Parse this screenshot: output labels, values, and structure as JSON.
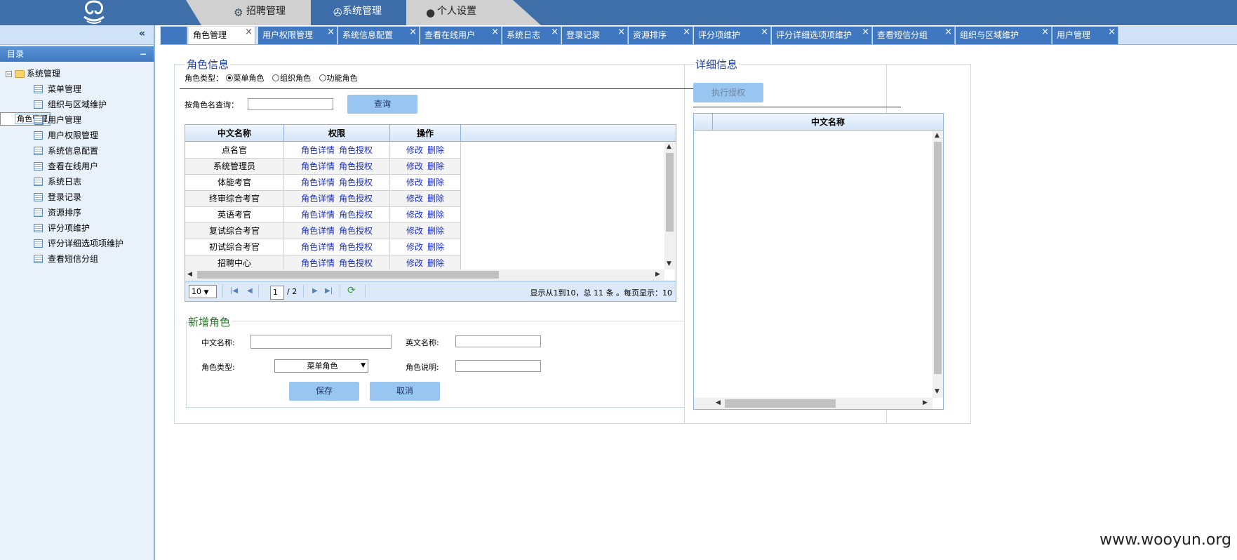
{
  "nav": {
    "tabs": [
      {
        "label": "招聘管理",
        "icon": "recruit-icon"
      },
      {
        "label": "系统管理",
        "icon": "gear-wheel-icon"
      },
      {
        "label": "个人设置",
        "icon": "user-icon"
      }
    ]
  },
  "sidebar": {
    "collapse_glyph": "«",
    "heading": "目录",
    "heading_toggle": "−",
    "root": "系统管理",
    "items": [
      "菜单管理",
      "组织与区域维护",
      "角色管理",
      "用户管理",
      "用户权限管理",
      "系统信息配置",
      "查看在线用户",
      "系统日志",
      "登录记录",
      "资源排序",
      "评分项维护",
      "评分详细选项项维护",
      "查看短信分组"
    ],
    "selected_index": 2
  },
  "content_tabs": [
    "角色管理",
    "用户权限管理",
    "系统信息配置",
    "查看在线用户",
    "系统日志",
    "登录记录",
    "资源排序",
    "评分项维护",
    "评分详细选项项维护",
    "查看短信分组",
    "组织与区域维护",
    "用户管理"
  ],
  "role_info": {
    "title": "角色信息",
    "type_label": "角色类型：",
    "types": [
      "菜单角色",
      "组织角色",
      "功能角色"
    ],
    "search_label": "按角色名查询：",
    "search_value": "",
    "search_button": "查询"
  },
  "grid": {
    "columns": [
      "中文名称",
      "权限",
      "操作"
    ],
    "link_detail": "角色详情",
    "link_grant": "角色授权",
    "link_edit": "修改",
    "link_delete": "删除",
    "rows": [
      "点名官",
      "系统管理员",
      "体能考官",
      "终审综合考官",
      "英语考官",
      "复试综合考官",
      "初试综合考官",
      "招聘中心"
    ]
  },
  "pager": {
    "page_size": "10",
    "current_page": "1",
    "total_pages": "/ 2",
    "summary": "显示从1到10，总 11 条 。每页显示：10"
  },
  "add_role": {
    "title": "新增角色",
    "cn_name_label": "中文名称:",
    "en_name_label": "英文名称:",
    "type_label": "角色类型:",
    "type_value": "菜单角色",
    "desc_label": "角色说明:",
    "save_button": "保存",
    "cancel_button": "取消"
  },
  "detail": {
    "title": "详细信息",
    "grant_button": "执行授权",
    "column": "中文名称"
  },
  "watermark": "www.wooyun.org",
  "colors": {
    "topbar": "#3f6fa8",
    "accent": "#3f78c0",
    "link": "#1a2fc9",
    "button": "#99c6f1"
  }
}
